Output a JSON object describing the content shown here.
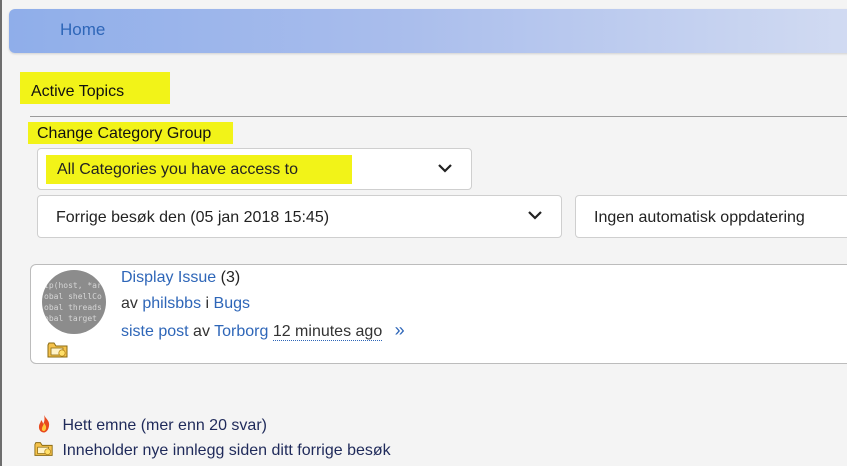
{
  "breadcrumb": {
    "home_label": "Home"
  },
  "page": {
    "title": "Active Topics"
  },
  "filters": {
    "group_label": "Change Category Group",
    "category_selected": "All Categories you have access to",
    "since_selected": "Forrige besøk den (05 jan 2018 15:45)",
    "refresh_selected": "Ingen automatisk oppdatering"
  },
  "topics": [
    {
      "title": "Display Issue",
      "replies": "(3)",
      "by_word": "av",
      "author": "philsbbs",
      "in_word": "i",
      "forum": "Bugs",
      "last_post_label": "siste post",
      "last_poster": "Torborg",
      "last_time": "12 minutes ago",
      "goto_icon": "»",
      "avatar_text": "ip(host, *ar\nobal shellCo\nobal threads\nobal target"
    }
  ],
  "legend": {
    "hot": "Hett emne (mer enn 20 svar)",
    "new": "Inneholder nye innlegg siden ditt forrige besøk"
  },
  "icons": {
    "dropdown": "chevron-down-icon",
    "new_posts": "folder-new-icon",
    "hot": "flame-icon"
  },
  "colors": {
    "highlight": "#f2f318",
    "link": "#2e66b8",
    "breadcrumb_start": "#8faeea",
    "breadcrumb_end": "#d3dcf2"
  }
}
